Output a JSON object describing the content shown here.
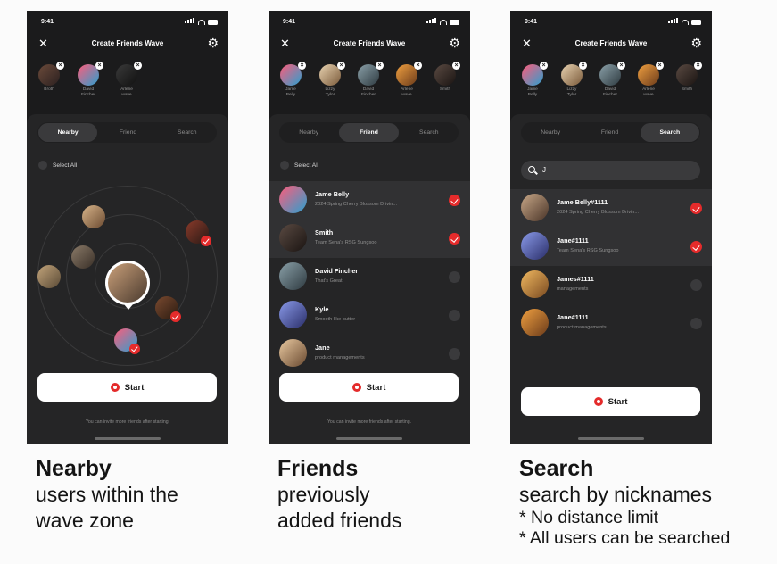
{
  "status_time": "9:41",
  "title": "Create Friends Wave",
  "tabs": [
    "Nearby",
    "Friend",
    "Search"
  ],
  "select_all": "Select All",
  "start_label": "Start",
  "invite_hint": "You can invite more friends after starting.",
  "screen1": {
    "selected": [
      "Broth",
      "David\nFincher",
      "Arlene\nwave"
    ],
    "active_tab": "Nearby"
  },
  "screen2": {
    "selected": [
      "Jame\nBelly",
      "Lizzy\nTylor",
      "David\nFincher",
      "Arlene\nwave",
      "Smith"
    ],
    "active_tab": "Friend",
    "friends": [
      {
        "name": "Jame Belly",
        "sub": "2024 Spring Cherry Blossom Drivin...",
        "checked": true
      },
      {
        "name": "Smith",
        "sub": "Team Sena's RSG Sungsoo",
        "checked": true
      },
      {
        "name": "David Fincher",
        "sub": "That's Great!",
        "checked": false
      },
      {
        "name": "Kyle",
        "sub": "Smooth like butter",
        "checked": false
      },
      {
        "name": "Jane",
        "sub": "product managements",
        "checked": false
      }
    ]
  },
  "screen3": {
    "selected": [
      "Jame\nBelly",
      "Lizzy\nTylor",
      "David\nFincher",
      "Arlene\nwave",
      "Smith"
    ],
    "active_tab": "Search",
    "query": "J",
    "results": [
      {
        "name": "Jame Belly#1111",
        "sub": "2024 Spring Cherry Blossom Drivin...",
        "checked": true
      },
      {
        "name": "Jane#1111",
        "sub": "Team Sena's RSG Sungsoo",
        "checked": true
      },
      {
        "name": "James#1111",
        "sub": "managements",
        "checked": false
      },
      {
        "name": "Jane#1111",
        "sub": "product managements",
        "checked": false
      }
    ]
  },
  "captions": {
    "nearby": {
      "title": "Nearby",
      "lines": [
        "users within the",
        "wave zone"
      ]
    },
    "friends": {
      "title": "Friends",
      "lines": [
        "previously",
        "added friends"
      ]
    },
    "search": {
      "title": "Search",
      "lines": [
        "search by nicknames",
        "* No distance limit",
        "* All users can be searched"
      ]
    }
  },
  "colors": {
    "accent": "#e52b2b",
    "phone_bg": "#1b1b1c",
    "sheet_bg": "#252526"
  }
}
